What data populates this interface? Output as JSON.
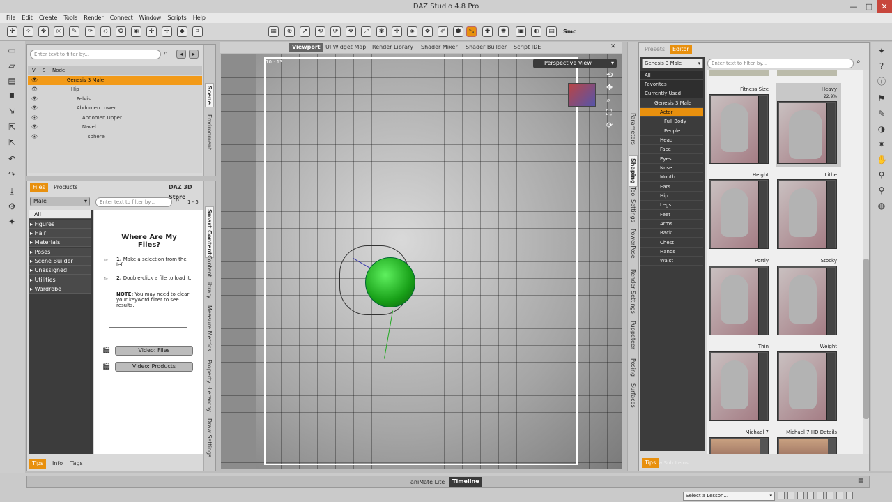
{
  "window": {
    "title": "DAZ Studio 4.8 Pro",
    "minimize": "—",
    "maximize": "□",
    "close": "✕"
  },
  "menu": [
    "File",
    "Edit",
    "Create",
    "Tools",
    "Render",
    "Connect",
    "Window",
    "Scripts",
    "Help"
  ],
  "toolbar": {
    "smc": "Smc"
  },
  "scene": {
    "filter_placeholder": "Enter text to filter by...",
    "col_v": "V",
    "col_s": "S",
    "col_node": "Node",
    "nodes": [
      {
        "label": "Genesis 3 Male",
        "selected": true
      },
      {
        "label": "Hip",
        "selected": false
      },
      {
        "label": "Pelvis",
        "selected": false
      },
      {
        "label": "Abdomen Lower",
        "selected": false
      },
      {
        "label": "Abdomen Upper",
        "selected": false
      },
      {
        "label": "Navel",
        "selected": false
      },
      {
        "label": "sphere",
        "selected": false
      }
    ],
    "vtabs": [
      "Scene",
      "Environment"
    ]
  },
  "content": {
    "tabs": [
      "Files",
      "Products"
    ],
    "store": "DAZ 3D Store",
    "dropdown": "Male",
    "filter_placeholder": "Enter text to filter by...",
    "count": "1 - 5",
    "categories": [
      "All",
      "Figures",
      "Hair",
      "Materials",
      "Poses",
      "Scene Builder",
      "Unassigned",
      "Utilities",
      "Wardrobe"
    ],
    "heading": "Where Are My Files?",
    "step1_num": "1.",
    "step1": "Make a selection from the left.",
    "step2_num": "2.",
    "step2": "Double-click a file to load it.",
    "note_label": "NOTE:",
    "note": "You may need to clear your keyword filter to see results.",
    "video1": "Video: Files",
    "video2": "Video: Products",
    "bottom_tabs": [
      "Tips",
      "Info",
      "Tags"
    ],
    "vtabs": [
      "Smart Content",
      "Content Library",
      "Measure Metrics",
      "Property Hierarchy",
      "Draw Settings"
    ]
  },
  "viewport": {
    "tabs": [
      "Viewport",
      "UI Widget Map",
      "Render Library",
      "Shader Mixer",
      "Shader Builder",
      "Script IDE"
    ],
    "aspect": "10 : 13",
    "view": "Perspective View"
  },
  "right_vtabs": [
    "Parameters",
    "Shaping",
    "Tool Settings",
    "PowerPose",
    "Render Settings",
    "Puppeteer",
    "Posing",
    "Surfaces"
  ],
  "shaping": {
    "tabs": [
      "Presets",
      "Editor"
    ],
    "figure": "Genesis 3 Male",
    "filter_placeholder": "Enter text to filter by...",
    "list": [
      "All",
      "Favorites",
      "Currently Used",
      "Genesis 3 Male",
      "Actor",
      "Full Body",
      "People",
      "Head",
      "Face",
      "Eyes",
      "Nose",
      "Mouth",
      "Ears",
      "Hip",
      "Legs",
      "Feet",
      "Arms",
      "Back",
      "Chest",
      "Hands",
      "Waist"
    ],
    "show_sub": "Show Sub Items",
    "tips": "Tips",
    "tiles": [
      {
        "label": "Fitness Size",
        "value": ""
      },
      {
        "label": "Heavy",
        "value": "22.9%"
      },
      {
        "label": "Height",
        "value": ""
      },
      {
        "label": "Lithe",
        "value": ""
      },
      {
        "label": "Portly",
        "value": ""
      },
      {
        "label": "Stocky",
        "value": ""
      },
      {
        "label": "Thin",
        "value": ""
      },
      {
        "label": "Weight",
        "value": ""
      },
      {
        "label": "Michael 7",
        "value": ""
      },
      {
        "label": "Michael 7 HD Details",
        "value": ""
      }
    ]
  },
  "bottom": {
    "animate": "aniMate Lite",
    "timeline": "Timeline",
    "lesson": "Select a Lesson..."
  },
  "colors": {
    "accent": "#e8900e",
    "dark_panel": "#3c3c3c"
  }
}
